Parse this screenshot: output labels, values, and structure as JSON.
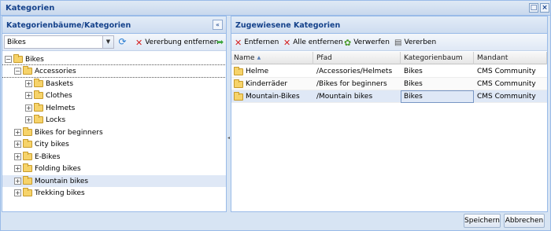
{
  "window": {
    "title": "Kategorien"
  },
  "left_panel": {
    "title": "Kategorienbäume/Kategorien",
    "collapse_glyph": "«",
    "tree_select": {
      "value": "Bikes"
    },
    "remove_inheritance_label": "Vererbung entfernen",
    "tree": [
      {
        "label": "Bikes",
        "expander": "−"
      },
      {
        "label": "Accessories",
        "expander": "−"
      },
      {
        "label": "Baskets",
        "expander": "+"
      },
      {
        "label": "Clothes",
        "expander": "+"
      },
      {
        "label": "Helmets",
        "expander": "+"
      },
      {
        "label": "Locks",
        "expander": "+"
      },
      {
        "label": "Bikes for beginners",
        "expander": "+"
      },
      {
        "label": "City bikes",
        "expander": "+"
      },
      {
        "label": "E-Bikes",
        "expander": "+"
      },
      {
        "label": "Folding bikes",
        "expander": "+"
      },
      {
        "label": "Mountain bikes",
        "expander": "+"
      },
      {
        "label": "Trekking bikes",
        "expander": "+"
      }
    ]
  },
  "right_panel": {
    "title": "Zugewiesene Kategorien",
    "toolbar": {
      "remove_label": "Entfernen",
      "remove_all_label": "Alle entfernen",
      "discard_label": "Verwerfen",
      "inherit_label": "Vererben"
    },
    "columns": [
      "Name",
      "Pfad",
      "Kategorienbaum",
      "Mandant"
    ],
    "sort_glyph": "▲",
    "rows": [
      {
        "name": "Helme",
        "path": "/Accessories/Helmets",
        "tree": "Bikes",
        "client": "CMS Community"
      },
      {
        "name": "Kinderräder",
        "path": "/Bikes for beginners",
        "tree": "Bikes",
        "client": "CMS Community"
      },
      {
        "name": "Mountain-Bikes",
        "path": "/Mountain bikes",
        "tree": "Bikes",
        "client": "CMS Community"
      }
    ]
  },
  "footer": {
    "save_label": "Speichern",
    "cancel_label": "Abbrechen"
  },
  "colors": {
    "accent": "#15428b",
    "selection": "#dfe8f6",
    "border": "#99bbe8"
  }
}
